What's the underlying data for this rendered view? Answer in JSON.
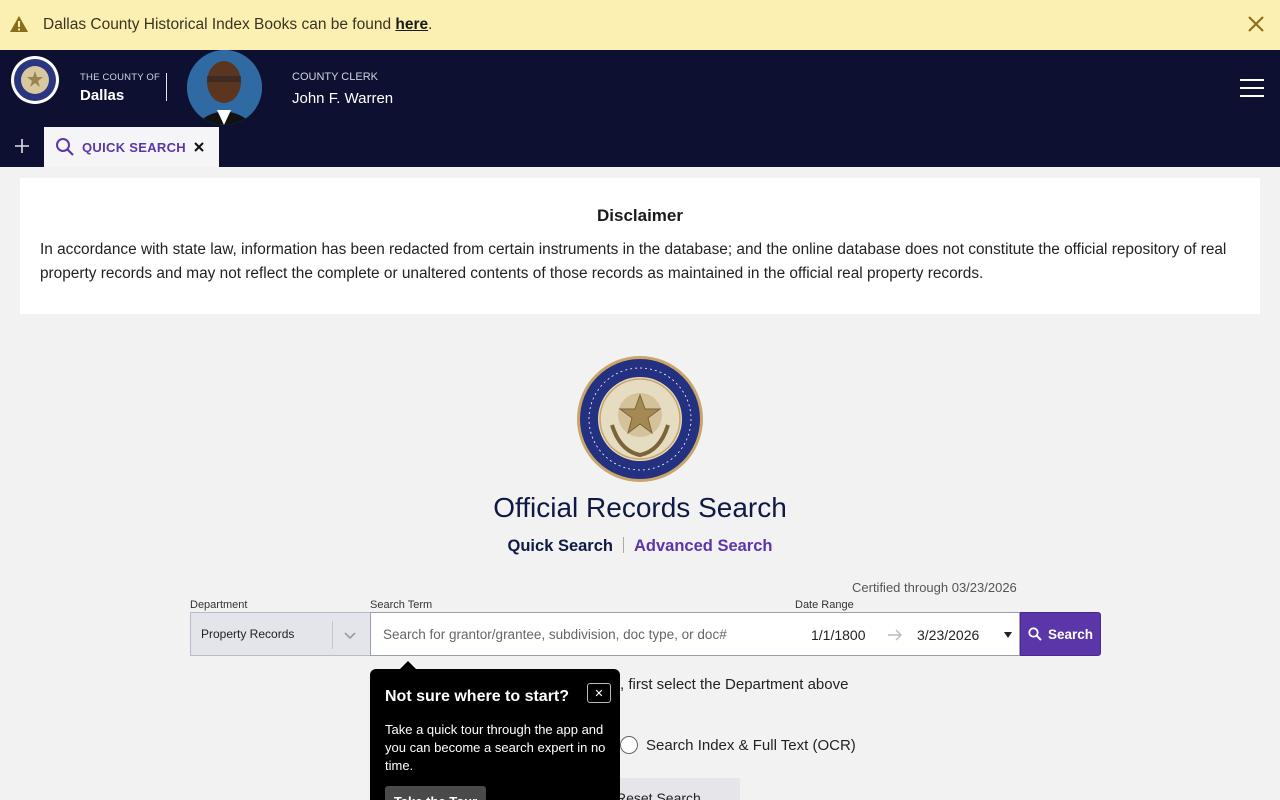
{
  "alert": {
    "message_prefix": "Dallas County Historical Index Books can be found ",
    "link_text": "here",
    "message_suffix": ".",
    "icon": "warning-icon",
    "close_icon": "close-icon",
    "bg_color": "#fbf0b2"
  },
  "header": {
    "county_label": "THE COUNTY OF",
    "county_name": "Dallas",
    "clerk_label": "COUNTY CLERK",
    "clerk_name": "John F. Warren",
    "bg_color": "#0d1030",
    "menu_icon": "hamburger-menu-icon"
  },
  "tabs": {
    "add_icon": "plus-icon",
    "items": [
      {
        "label": "QUICK SEARCH",
        "icon": "search-icon",
        "close_icon": "close-icon"
      }
    ]
  },
  "disclaimer": {
    "title": "Disclaimer",
    "text": "In accordance with state law, information has been redacted from certain instruments in the database; and the online database does not constitute the official repository of real property records and may not reflect the complete or unaltered contents of those records as maintained in the official real property records."
  },
  "main": {
    "title": "Official Records Search",
    "quick_search": "Quick Search",
    "advanced_search": "Advanced Search",
    "certified": "Certified through 03/23/2026",
    "accent_color": "#5b36a8"
  },
  "form": {
    "department_label": "Department",
    "department_value": "Property Records",
    "search_term_label": "Search Term",
    "search_placeholder": "Search for grantor/grantee, subdivision, doc type, or doc#",
    "date_range_label": "Date Range",
    "date_from": "1/1/1800",
    "date_to": "3/23/2026",
    "search_button": "Search",
    "hint": ", first select the Department above",
    "ocr_option": "Search Index & Full Text (OCR)",
    "reset_button": "Reset Search"
  },
  "tour": {
    "title": "Not sure where to start?",
    "body": "Take a quick tour through the app and you can become a search expert in no time.",
    "button": "Take the Tour",
    "close_label": "✕"
  }
}
